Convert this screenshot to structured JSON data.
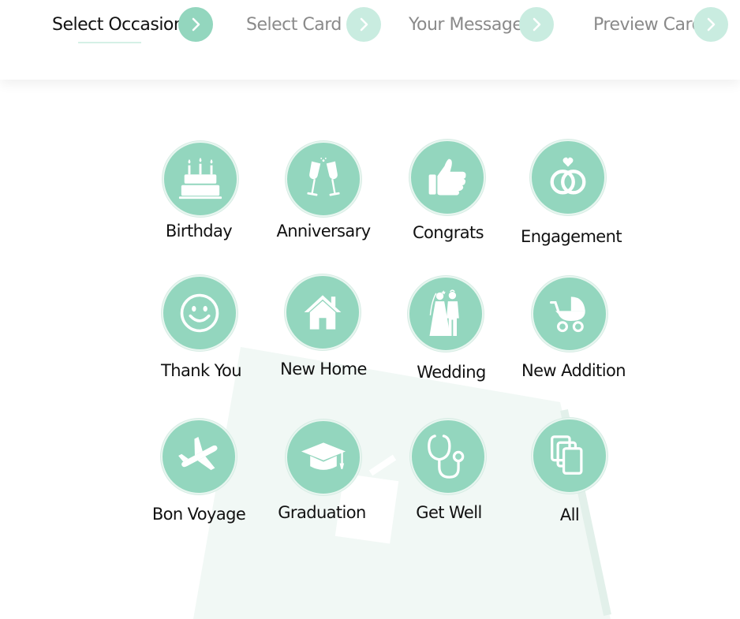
{
  "steps": [
    {
      "label": "Select Occasion",
      "active": true
    },
    {
      "label": "Select Card",
      "active": false
    },
    {
      "label": "Your Message",
      "active": false
    },
    {
      "label": "Preview Card",
      "active": false
    }
  ],
  "occasions": [
    {
      "label": "Birthday",
      "icon": "birthday-cake-icon"
    },
    {
      "label": "Anniversary",
      "icon": "champagne-glasses-icon"
    },
    {
      "label": "Congrats",
      "icon": "thumbs-up-icon"
    },
    {
      "label": "Engagement",
      "icon": "rings-icon"
    },
    {
      "label": "Thank You",
      "icon": "smiley-icon"
    },
    {
      "label": "New Home",
      "icon": "house-icon"
    },
    {
      "label": "Wedding",
      "icon": "bride-groom-icon"
    },
    {
      "label": "New Addition",
      "icon": "baby-stroller-icon"
    },
    {
      "label": "Bon Voyage",
      "icon": "airplane-icon"
    },
    {
      "label": "Graduation",
      "icon": "graduation-cap-icon"
    },
    {
      "label": "Get Well",
      "icon": "stethoscope-icon"
    },
    {
      "label": "All",
      "icon": "cards-stack-icon"
    }
  ],
  "colors": {
    "accent": "#93d6be",
    "accent_light": "#c9ece0",
    "watermark": "#f1f8f5"
  }
}
